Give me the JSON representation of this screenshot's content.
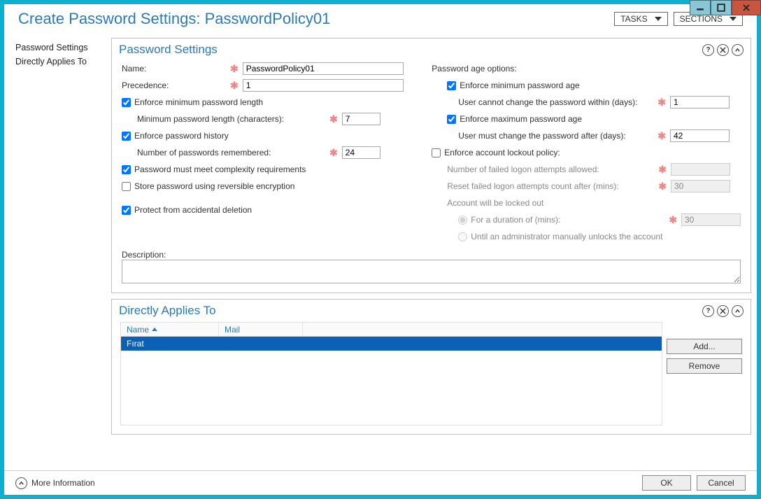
{
  "header": {
    "title_prefix": "Create Password Settings: ",
    "title_value": "PasswordPolicy01",
    "tasks_label": "TASKS",
    "sections_label": "SECTIONS"
  },
  "sidebar": {
    "items": [
      "Password Settings",
      "Directly Applies To"
    ]
  },
  "panel_ps": {
    "title": "Password Settings",
    "name_label": "Name:",
    "name_value": "PasswordPolicy01",
    "precedence_label": "Precedence:",
    "precedence_value": "1",
    "enforce_min_len_label": "Enforce minimum password length",
    "min_len_label": "Minimum password length (characters):",
    "min_len_value": "7",
    "enforce_history_label": "Enforce password history",
    "history_label": "Number of passwords remembered:",
    "history_value": "24",
    "complexity_label": "Password must meet complexity requirements",
    "reversible_label": "Store password using reversible encryption",
    "protect_label": "Protect from accidental deletion",
    "description_label": "Description:",
    "age_options_label": "Password age options:",
    "min_age_label": "Enforce minimum password age",
    "min_age_desc": "User cannot change the password within (days):",
    "min_age_value": "1",
    "max_age_label": "Enforce maximum password age",
    "max_age_desc": "User must change the password after (days):",
    "max_age_value": "42",
    "lockout_label": "Enforce account lockout policy:",
    "failed_attempts_label": "Number of failed logon attempts allowed:",
    "failed_attempts_value": "",
    "reset_after_label": "Reset failed logon attempts count after (mins):",
    "reset_after_value": "30",
    "locked_out_label": "Account will be locked out",
    "duration_label": "For a duration of (mins):",
    "duration_value": "30",
    "until_admin_label": "Until an administrator manually unlocks the account"
  },
  "panel_dat": {
    "title": "Directly Applies To",
    "col_name": "Name",
    "col_mail": "Mail",
    "rows": [
      {
        "name": "Fırat",
        "mail": ""
      }
    ],
    "add_label": "Add...",
    "remove_label": "Remove"
  },
  "footer": {
    "more_info": "More Information",
    "ok": "OK",
    "cancel": "Cancel"
  }
}
